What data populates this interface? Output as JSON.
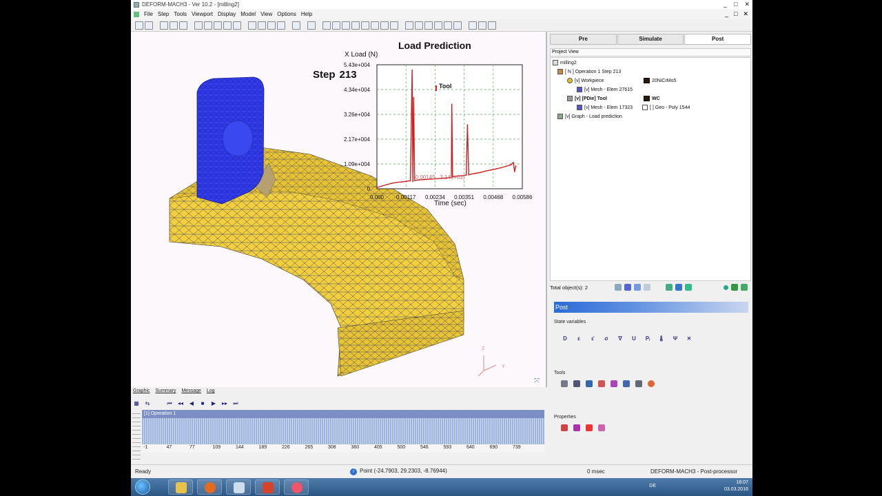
{
  "window": {
    "title": "DEFORM-MACH3 - Ver 10.2 - [milling2]",
    "controls": [
      "_",
      "□",
      "✕"
    ],
    "mdi_controls": [
      "_",
      "□",
      "✕"
    ]
  },
  "menu": [
    "File",
    "Step",
    "Tools",
    "Viewport",
    "Display",
    "Model",
    "View",
    "Options",
    "Help"
  ],
  "viewport": {
    "chart_title": "Load Prediction",
    "step_label": "Step",
    "step_value": "213",
    "axis_triad": {
      "z": "Z",
      "y": "Y"
    }
  },
  "chart_data": {
    "type": "line",
    "title": "Load Prediction",
    "xlabel": "Time (sec)",
    "ylabel": "X Load (N)",
    "xlim": [
      0,
      0.00586
    ],
    "ylim": [
      0,
      54300
    ],
    "x_ticks": [
      "0.000",
      "0.00117",
      "0.00234",
      "0.00351",
      "0.00468",
      "0.00586"
    ],
    "y_ticks": [
      "0",
      "1.09e+004",
      "2.17e+004",
      "3.26e+004",
      "4.34e+004",
      "5.43e+004"
    ],
    "grid": true,
    "legend_position": "top-left",
    "annotation": "(0.00145 , 3.14e+03)",
    "series": [
      {
        "name": "Tool",
        "color": "#cc1f1f",
        "x": [
          0,
          0.0002,
          0.0004,
          0.0006,
          0.0008,
          0.001,
          0.0012,
          0.00135,
          0.00142,
          0.00145,
          0.00148,
          0.00152,
          0.0017,
          0.002,
          0.0023,
          0.0026,
          0.0029,
          0.003,
          0.00302,
          0.00305,
          0.0031,
          0.0033,
          0.0035,
          0.0036,
          0.00365,
          0.0037,
          0.0038,
          0.004,
          0.0042,
          0.0044,
          0.0046,
          0.0048,
          0.005,
          0.0052,
          0.0054,
          0.0055,
          0.00555,
          0.0056
        ],
        "y": [
          500,
          1200,
          1800,
          2400,
          2800,
          3000,
          3300,
          3500,
          52000,
          3140,
          40000,
          3600,
          3900,
          4100,
          4300,
          4600,
          4800,
          5000,
          37000,
          5200,
          5400,
          5600,
          5800,
          6000,
          28000,
          6100,
          6400,
          6800,
          7200,
          7800,
          8200,
          8700,
          9200,
          9800,
          10500,
          11500,
          7500,
          10000
        ]
      }
    ]
  },
  "viewport_tabs": [
    "Graphic",
    "Summary",
    "Message",
    "Log"
  ],
  "timeline": {
    "operation_label": "[1] Operation 1",
    "ticks": [
      "-1",
      "47",
      "77",
      "109",
      "144",
      "189",
      "226",
      "265",
      "308",
      "360",
      "405",
      "500",
      "546",
      "593",
      "640",
      "690",
      "739"
    ]
  },
  "right_panel": {
    "tabs": [
      "Pre",
      "Simulate",
      "Post"
    ],
    "active_tab": "Post",
    "project_view_label": "Project View",
    "tree": {
      "root": "milling2",
      "operation": "[ N ] Operation 1  Step 213",
      "workpiece": "[v] Workpiece",
      "workpiece_material": "20NiCrMo5",
      "workpiece_mesh": "[v] Mesh - Elem 27615",
      "tool": "[v] [PDie] Tool",
      "tool_material": "WC",
      "tool_mesh": "[v] Mesh - Elem 17323",
      "tool_geo": "[ ] Geo - Poly 1544",
      "graph": "[v] Graph - Load prediction"
    },
    "total_objects": "Total object(s): 2",
    "post_header": "Post",
    "state_variables_label": "State variables",
    "tools_label": "Tools",
    "properties_label": "Properties",
    "state_variable_icons": [
      "D",
      "ε",
      "ε̇",
      "σ",
      "∇",
      "U",
      "Pᵢ",
      "🌡",
      "Ψ",
      "✕"
    ]
  },
  "statusbar": {
    "ready": "Ready",
    "point": "Point (-24.7903, 29.2303, -8.76944)",
    "time": "0 msec",
    "app": "DEFORM-MACH3  -  Post-processor"
  },
  "taskbar": {
    "lang": "DE",
    "clock_time": "18:07",
    "clock_date": "03.03.2016"
  }
}
